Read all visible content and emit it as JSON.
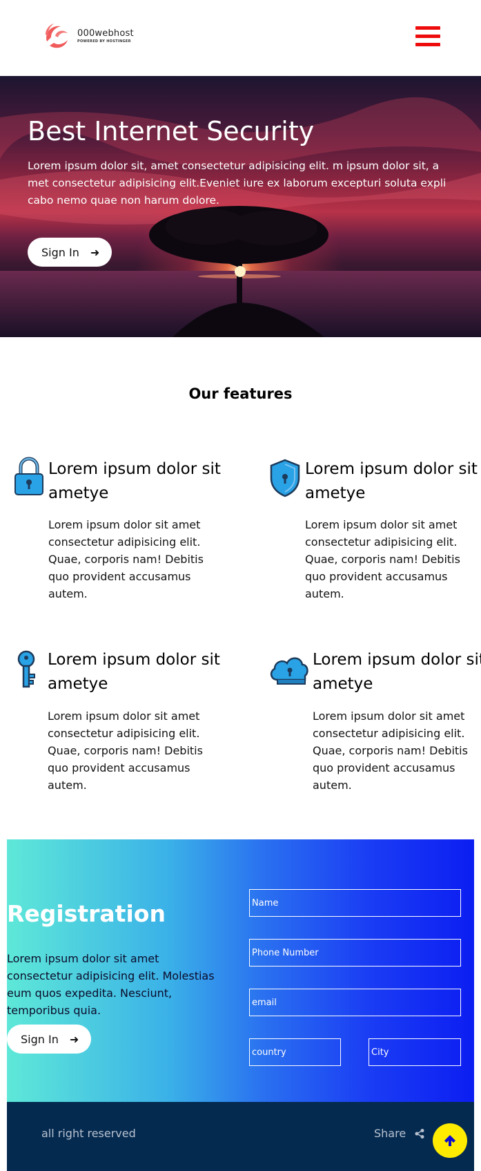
{
  "header": {
    "logo_title": "000webhost",
    "logo_subtitle": "POWERED BY HOSTINGER",
    "menu_icon": "hamburger-menu-icon"
  },
  "hero": {
    "title": "Best Internet Security",
    "text": "Lorem ipsum dolor sit, amet consectetur adipisicing elit. m ipsum dolor sit, a met consectetur adipisicing elit.Eveniet iure ex laborum excepturi soluta expli cabo nemo quae non harum dolore.",
    "button_label": "Sign In",
    "button_icon": "arrow-right-icon"
  },
  "features": {
    "title": "Our features",
    "items": [
      {
        "icon": "padlock-icon",
        "heading": "Lorem ipsum dolor sit ametye",
        "text": "Lorem ipsum dolor sit amet consectetur adipisicing elit. Quae, corporis nam! Debitis quo provident accusamus autem."
      },
      {
        "icon": "shield-icon",
        "heading": "Lorem ipsum dolor sit ametye",
        "text": "Lorem ipsum dolor sit amet consectetur adipisicing elit. Quae, corporis nam! Debitis quo provident accusamus autem."
      },
      {
        "icon": "key-icon",
        "heading": "Lorem ipsum dolor sit ametye",
        "text": "Lorem ipsum dolor sit amet consectetur adipisicing elit. Quae, corporis nam! Debitis quo provident accusamus autem."
      },
      {
        "icon": "cloud-lock-icon",
        "heading": "Lorem ipsum dolor sit ametye",
        "text": "Lorem ipsum dolor sit amet consectetur adipisicing elit. Quae, corporis nam! Debitis quo provident accusamus autem."
      }
    ]
  },
  "registration": {
    "title": "Registration",
    "text": "Lorem ipsum dolor sit amet consectetur adipisicing elit. Molestias eum quos expedita. Nesciunt, temporibus quia.",
    "button_label": "Sign In",
    "fields": {
      "name": "Name",
      "phone": "Phone Number",
      "email": "email",
      "country": "country",
      "city": "City"
    }
  },
  "footer": {
    "copyright": "all right reserved",
    "share_label": "Share",
    "share_icon": "share-icon",
    "scroll_top_icon": "arrow-up-icon"
  },
  "colors": {
    "accent_red": "#ee0b0b",
    "footer_bg": "#052a50",
    "scroll_top_bg": "#ffeb00",
    "icon_blue": "#2aa2e6"
  }
}
